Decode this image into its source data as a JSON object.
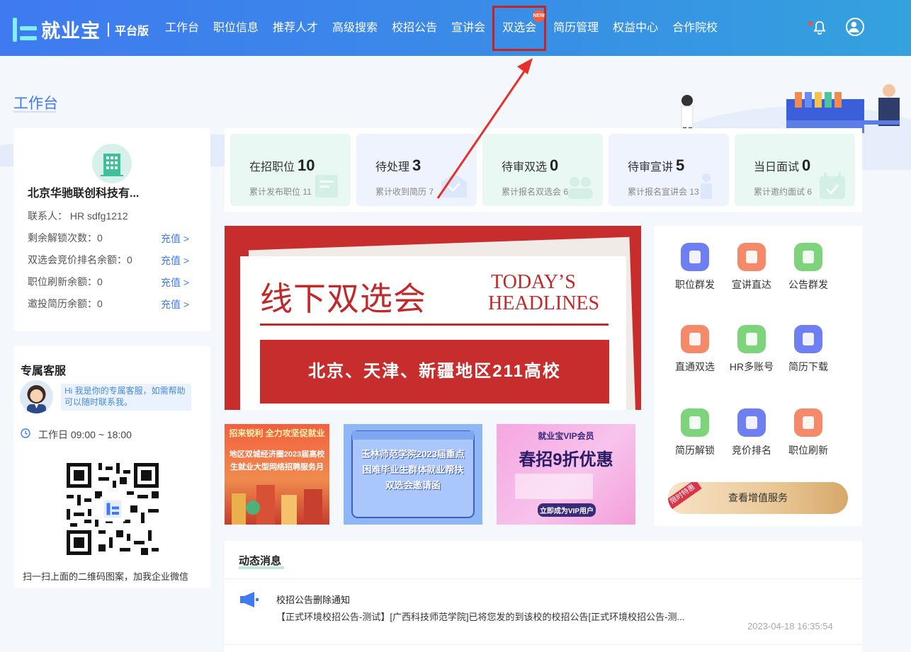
{
  "brand": {
    "name": "就业宝",
    "edition": "平台版"
  },
  "nav": {
    "items": [
      "工作台",
      "职位信息",
      "推荐人才",
      "高级搜索",
      "校招公告",
      "宣讲会",
      "双选会",
      "简历管理",
      "权益中心",
      "合作院校"
    ],
    "new_badge": "NEW"
  },
  "page_title": "工作台",
  "company": {
    "name": "北京华驰联创科技有...",
    "contact_label": "联系人：",
    "contact_value": "HR sdfg1212",
    "rows": [
      {
        "label": "剩余解锁次数：",
        "value": "0",
        "link": "充值 >"
      },
      {
        "label": "双选会竞价排名余额：",
        "value": "0",
        "link": "充值 >"
      },
      {
        "label": "职位刷新余额：",
        "value": "0",
        "link": "充值 >"
      },
      {
        "label": "邀投简历余额：",
        "value": "0",
        "link": "充值 >"
      }
    ]
  },
  "service": {
    "title": "专属客服",
    "greeting": "Hi 我是你的专属客服，如需帮助可以随时联系我。",
    "hours": "工作日 09:00 ~ 18:00",
    "qr_caption": "扫一扫上面的二维码图案，加我企业微信"
  },
  "stats": [
    {
      "label": "在招职位",
      "value": "10",
      "sub": "累计发布职位 11",
      "color": "#e9f8f3"
    },
    {
      "label": "待处理",
      "value": "3",
      "sub": "累计收到简历 7",
      "color": "#eef3fd"
    },
    {
      "label": "待审双选",
      "value": "0",
      "sub": "累计报名双选会 6",
      "color": "#e9f8f3"
    },
    {
      "label": "待审宣讲",
      "value": "5",
      "sub": "累计报名宣讲会 13",
      "color": "#eef3fd"
    },
    {
      "label": "当日面试",
      "value": "0",
      "sub": "累计邀约面试 6",
      "color": "#e9f8f3"
    }
  ],
  "banner": {
    "title": "线下双选会",
    "en_line1": "TODAY’S",
    "en_line2": "HEADLINES",
    "subtitle": "北京、天津、新疆地区211高校"
  },
  "promos": [
    {
      "line1": "招来锐利 全力攻坚促就业",
      "line2": "地区双城经济圈2023届高校",
      "line3": "生就业大型网络招聘服务月"
    },
    {
      "line1": "玉林师范学院2023届重点",
      "line2": "困难毕业生群体就业帮扶",
      "line3": "双选会邀请函"
    },
    {
      "line1": "就业宝VIP会员",
      "line2": "春招9折优惠",
      "line3": "立即成为VIP用户"
    }
  ],
  "quick_services": [
    {
      "label": "职位群发",
      "color": "#6d7ff2",
      "icon": "share-icon"
    },
    {
      "label": "宣讲直达",
      "color": "#f58a6a",
      "icon": "speaker-icon"
    },
    {
      "label": "公告群发",
      "color": "#7ed47b",
      "icon": "announcement-icon"
    },
    {
      "label": "直通双选",
      "color": "#f58a6a",
      "icon": "group-icon"
    },
    {
      "label": "HR多账号",
      "color": "#7ed47b",
      "icon": "users-icon"
    },
    {
      "label": "简历下载",
      "color": "#6d7ff2",
      "icon": "download-icon"
    },
    {
      "label": "简历解锁",
      "color": "#7ed47b",
      "icon": "unlock-icon"
    },
    {
      "label": "竞价排名",
      "color": "#6d7ff2",
      "icon": "ranking-icon"
    },
    {
      "label": "职位刷新",
      "color": "#f58a6a",
      "icon": "refresh-icon"
    }
  ],
  "vip": {
    "ribbon": "限时特惠",
    "label": "查看增值服务"
  },
  "news": {
    "title": "动态消息",
    "items": [
      {
        "title": "校招公告删除通知",
        "body": "【正式环境校招公告-测试】[广西科技师范学院]已将您发的到该校的校招公告[正式环境校招公告-测...",
        "time": "2023-04-18 16:35:54"
      }
    ]
  },
  "colors": {
    "accent": "#3f7af0",
    "highlight_box": "#c62323",
    "arrow": "#e8302a"
  }
}
